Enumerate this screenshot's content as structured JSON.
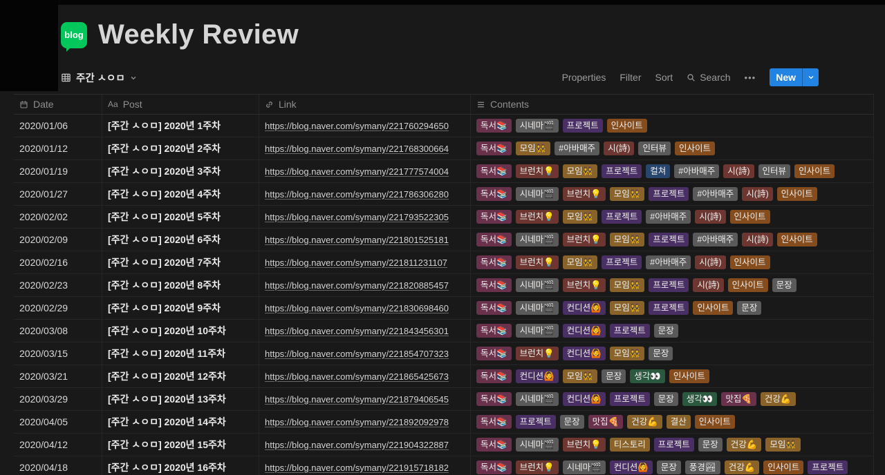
{
  "page": {
    "title": "Weekly Review",
    "logo_label": "blog"
  },
  "toolbar": {
    "view_name": "주간 ㅅㅇㅁ",
    "properties": "Properties",
    "filter": "Filter",
    "sort": "Sort",
    "search": "Search",
    "more": "•••",
    "new_label": "New",
    "new_button_color": "#2383E2"
  },
  "table": {
    "columns": [
      {
        "label": "Date",
        "icon": "calendar-icon"
      },
      {
        "label": "Post",
        "icon": "title-icon"
      },
      {
        "label": "Link",
        "icon": "link-icon"
      },
      {
        "label": "Contents",
        "icon": "list-icon"
      }
    ],
    "tag_palette": {
      "gray": "#5A5A5A",
      "brown": "#603B2C",
      "orange": "#854C1D",
      "yellow": "#89632A",
      "green": "#2B593F",
      "blue": "#28456C",
      "purple": "#492F64",
      "pink": "#69314C",
      "red": "#6E3630"
    },
    "rows": [
      {
        "date": "2020/01/06",
        "post": "[주간 ㅅㅇㅁ] 2020년 1주차",
        "link": "https://blog.naver.com/symany/221760294650",
        "tags": [
          [
            "독서📚",
            "pink"
          ],
          [
            "시네마🎬",
            "gray"
          ],
          [
            "프로젝트",
            "purple"
          ],
          [
            "인사이트",
            "orange"
          ]
        ]
      },
      {
        "date": "2020/01/12",
        "post": "[주간 ㅅㅇㅁ] 2020년 2주차",
        "link": "https://blog.naver.com/symany/221768300664",
        "tags": [
          [
            "독서📚",
            "pink"
          ],
          [
            "모임👯",
            "yellow"
          ],
          [
            "#아바매주",
            "gray"
          ],
          [
            "시(詩)",
            "red"
          ],
          [
            "인터뷰",
            "gray"
          ],
          [
            "인사이트",
            "orange"
          ]
        ]
      },
      {
        "date": "2020/01/19",
        "post": "[주간 ㅅㅇㅁ] 2020년 3주차",
        "link": "https://blog.naver.com/symany/221777574004",
        "tags": [
          [
            "독서📚",
            "pink"
          ],
          [
            "브런치💡",
            "red"
          ],
          [
            "모임👯",
            "yellow"
          ],
          [
            "프로젝트",
            "purple"
          ],
          [
            "컬쳐",
            "blue"
          ],
          [
            "#아바매주",
            "gray"
          ],
          [
            "시(詩)",
            "red"
          ],
          [
            "인터뷰",
            "gray"
          ],
          [
            "인사이트",
            "orange"
          ]
        ]
      },
      {
        "date": "2020/01/27",
        "post": "[주간 ㅅㅇㅁ] 2020년 4주차",
        "link": "https://blog.naver.com/symany/221786306280",
        "tags": [
          [
            "독서📚",
            "pink"
          ],
          [
            "시네마🎬",
            "gray"
          ],
          [
            "브런치💡",
            "red"
          ],
          [
            "모임👯",
            "yellow"
          ],
          [
            "프로젝트",
            "purple"
          ],
          [
            "#아바매주",
            "gray"
          ],
          [
            "시(詩)",
            "red"
          ],
          [
            "인사이트",
            "orange"
          ]
        ]
      },
      {
        "date": "2020/02/02",
        "post": "[주간 ㅅㅇㅁ] 2020년 5주차",
        "link": "https://blog.naver.com/symany/221793522305",
        "tags": [
          [
            "독서📚",
            "pink"
          ],
          [
            "브런치💡",
            "red"
          ],
          [
            "모임👯",
            "yellow"
          ],
          [
            "프로젝트",
            "purple"
          ],
          [
            "#아바매주",
            "gray"
          ],
          [
            "시(詩)",
            "red"
          ],
          [
            "인사이트",
            "orange"
          ]
        ]
      },
      {
        "date": "2020/02/09",
        "post": "[주간 ㅅㅇㅁ] 2020년 6주차",
        "link": "https://blog.naver.com/symany/221801525181",
        "tags": [
          [
            "독서📚",
            "pink"
          ],
          [
            "시네마🎬",
            "gray"
          ],
          [
            "브런치💡",
            "red"
          ],
          [
            "모임👯",
            "yellow"
          ],
          [
            "프로젝트",
            "purple"
          ],
          [
            "#아바매주",
            "gray"
          ],
          [
            "시(詩)",
            "red"
          ],
          [
            "인사이트",
            "orange"
          ]
        ]
      },
      {
        "date": "2020/02/16",
        "post": "[주간 ㅅㅇㅁ] 2020년 7주차",
        "link": "https://blog.naver.com/symany/221811231107",
        "tags": [
          [
            "독서📚",
            "pink"
          ],
          [
            "브런치💡",
            "red"
          ],
          [
            "모임👯",
            "yellow"
          ],
          [
            "프로젝트",
            "purple"
          ],
          [
            "#아바매주",
            "gray"
          ],
          [
            "시(詩)",
            "red"
          ],
          [
            "인사이트",
            "orange"
          ]
        ]
      },
      {
        "date": "2020/02/23",
        "post": "[주간 ㅅㅇㅁ] 2020년 8주차",
        "link": "https://blog.naver.com/symany/221820885457",
        "tags": [
          [
            "독서📚",
            "pink"
          ],
          [
            "시네마🎬",
            "gray"
          ],
          [
            "브런치💡",
            "red"
          ],
          [
            "모임👯",
            "yellow"
          ],
          [
            "프로젝트",
            "purple"
          ],
          [
            "시(詩)",
            "red"
          ],
          [
            "인사이트",
            "orange"
          ],
          [
            "문장",
            "gray"
          ]
        ]
      },
      {
        "date": "2020/02/29",
        "post": "[주간 ㅅㅇㅁ] 2020년 9주차",
        "link": "https://blog.naver.com/symany/221830698460",
        "tags": [
          [
            "독서📚",
            "pink"
          ],
          [
            "시네마🎬",
            "gray"
          ],
          [
            "컨디션🙆",
            "purple"
          ],
          [
            "모임👯",
            "yellow"
          ],
          [
            "프로젝트",
            "purple"
          ],
          [
            "인사이트",
            "orange"
          ],
          [
            "문장",
            "gray"
          ]
        ]
      },
      {
        "date": "2020/03/08",
        "post": "[주간 ㅅㅇㅁ] 2020년 10주차",
        "link": "https://blog.naver.com/symany/221843456301",
        "tags": [
          [
            "독서📚",
            "pink"
          ],
          [
            "시네마🎬",
            "gray"
          ],
          [
            "컨디션🙆",
            "purple"
          ],
          [
            "프로젝트",
            "purple"
          ],
          [
            "문장",
            "gray"
          ]
        ]
      },
      {
        "date": "2020/03/15",
        "post": "[주간 ㅅㅇㅁ] 2020년 11주차",
        "link": "https://blog.naver.com/symany/221854707323",
        "tags": [
          [
            "독서📚",
            "pink"
          ],
          [
            "브런치💡",
            "red"
          ],
          [
            "컨디션🙆",
            "purple"
          ],
          [
            "모임👯",
            "yellow"
          ],
          [
            "문장",
            "gray"
          ]
        ]
      },
      {
        "date": "2020/03/21",
        "post": "[주간 ㅅㅇㅁ] 2020년 12주차",
        "link": "https://blog.naver.com/symany/221865425673",
        "tags": [
          [
            "독서📚",
            "pink"
          ],
          [
            "컨디션🙆",
            "purple"
          ],
          [
            "모임👯",
            "yellow"
          ],
          [
            "문장",
            "gray"
          ],
          [
            "생각👀",
            "green"
          ],
          [
            "인사이트",
            "orange"
          ]
        ]
      },
      {
        "date": "2020/03/29",
        "post": "[주간 ㅅㅇㅁ] 2020년 13주차",
        "link": "https://blog.naver.com/symany/221879406545",
        "tags": [
          [
            "독서📚",
            "pink"
          ],
          [
            "시네마🎬",
            "gray"
          ],
          [
            "컨디션🙆",
            "purple"
          ],
          [
            "프로젝트",
            "purple"
          ],
          [
            "문장",
            "gray"
          ],
          [
            "생각👀",
            "green"
          ],
          [
            "맛집🍕",
            "pink"
          ],
          [
            "건강💪",
            "yellow"
          ]
        ]
      },
      {
        "date": "2020/04/05",
        "post": "[주간 ㅅㅇㅁ] 2020년 14주차",
        "link": "https://blog.naver.com/symany/221892092978",
        "tags": [
          [
            "독서📚",
            "pink"
          ],
          [
            "프로젝트",
            "purple"
          ],
          [
            "문장",
            "gray"
          ],
          [
            "맛집🍕",
            "pink"
          ],
          [
            "건강💪",
            "yellow"
          ],
          [
            "결산",
            "yellow"
          ],
          [
            "인사이트",
            "orange"
          ]
        ]
      },
      {
        "date": "2020/04/12",
        "post": "[주간 ㅅㅇㅁ] 2020년 15주차",
        "link": "https://blog.naver.com/symany/221904322887",
        "tags": [
          [
            "독서📚",
            "pink"
          ],
          [
            "시네마🎬",
            "gray"
          ],
          [
            "브런치💡",
            "red"
          ],
          [
            "티스토리",
            "yellow"
          ],
          [
            "프로젝트",
            "purple"
          ],
          [
            "문장",
            "gray"
          ],
          [
            "건강💪",
            "yellow"
          ],
          [
            "모임👯",
            "yellow"
          ]
        ]
      },
      {
        "date": "2020/04/18",
        "post": "[주간 ㅅㅇㅁ] 2020년 16주차",
        "link": "https://blog.naver.com/symany/221915718182",
        "tags": [
          [
            "독서📚",
            "pink"
          ],
          [
            "브런치💡",
            "red"
          ],
          [
            "시네마🎬",
            "gray"
          ],
          [
            "컨디션🙆",
            "purple"
          ],
          [
            "문장",
            "gray"
          ],
          [
            "풍경🏞",
            "gray"
          ],
          [
            "건강💪",
            "yellow"
          ],
          [
            "인사이트",
            "orange"
          ],
          [
            "프로젝트",
            "purple"
          ]
        ]
      }
    ]
  }
}
